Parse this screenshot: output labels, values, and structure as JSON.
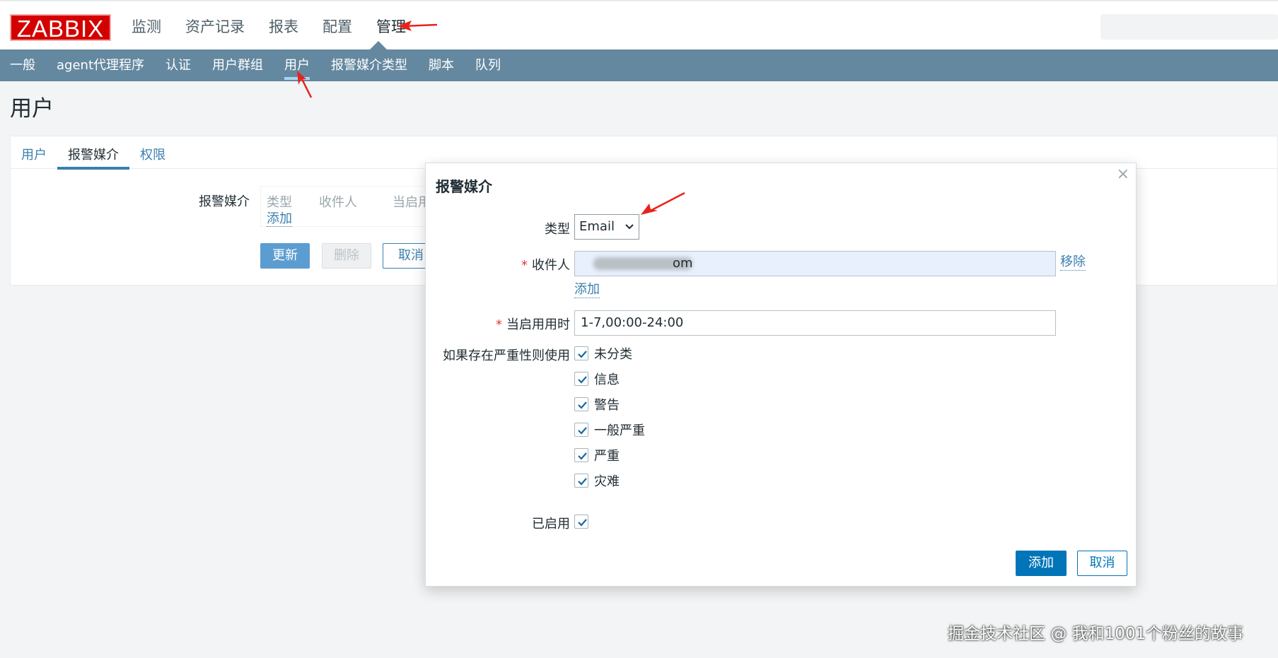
{
  "brand": {
    "logo": "ZABBIX"
  },
  "topnav": [
    "监测",
    "资产记录",
    "报表",
    "配置",
    "管理"
  ],
  "subnav": [
    "一般",
    "agent代理程序",
    "认证",
    "用户群组",
    "用户",
    "报警媒介类型",
    "脚本",
    "队列"
  ],
  "page": {
    "title": "用户"
  },
  "tabs": [
    "用户",
    "报警媒介",
    "权限"
  ],
  "media_section": {
    "label": "报警媒介",
    "columns": [
      "类型",
      "收件人",
      "当启用"
    ],
    "add_link": "添加"
  },
  "form_buttons": {
    "update": "更新",
    "delete": "删除",
    "cancel": "取消"
  },
  "dialog": {
    "title": "报警媒介",
    "close": "×",
    "type_label": "类型",
    "type_value": "Email",
    "recipient_label": "收件人",
    "recipient_value": "om",
    "remove_link": "移除",
    "add_link": "添加",
    "period_label": "当启用用时",
    "period_value": "1-7,00:00-24:00",
    "severity_label": "如果存在严重性则使用",
    "severities": [
      "未分类",
      "信息",
      "警告",
      "一般严重",
      "严重",
      "灾难"
    ],
    "enabled_label": "已启用",
    "add_button": "添加",
    "cancel_button": "取消"
  },
  "watermark": "掘金技术社区 @ 我和1001个粉丝的故事",
  "colors": {
    "header": "#64889f",
    "link": "#3b7fae",
    "primary": "#0275b8",
    "logo": "#d40000",
    "annotation": "#e8221c"
  }
}
